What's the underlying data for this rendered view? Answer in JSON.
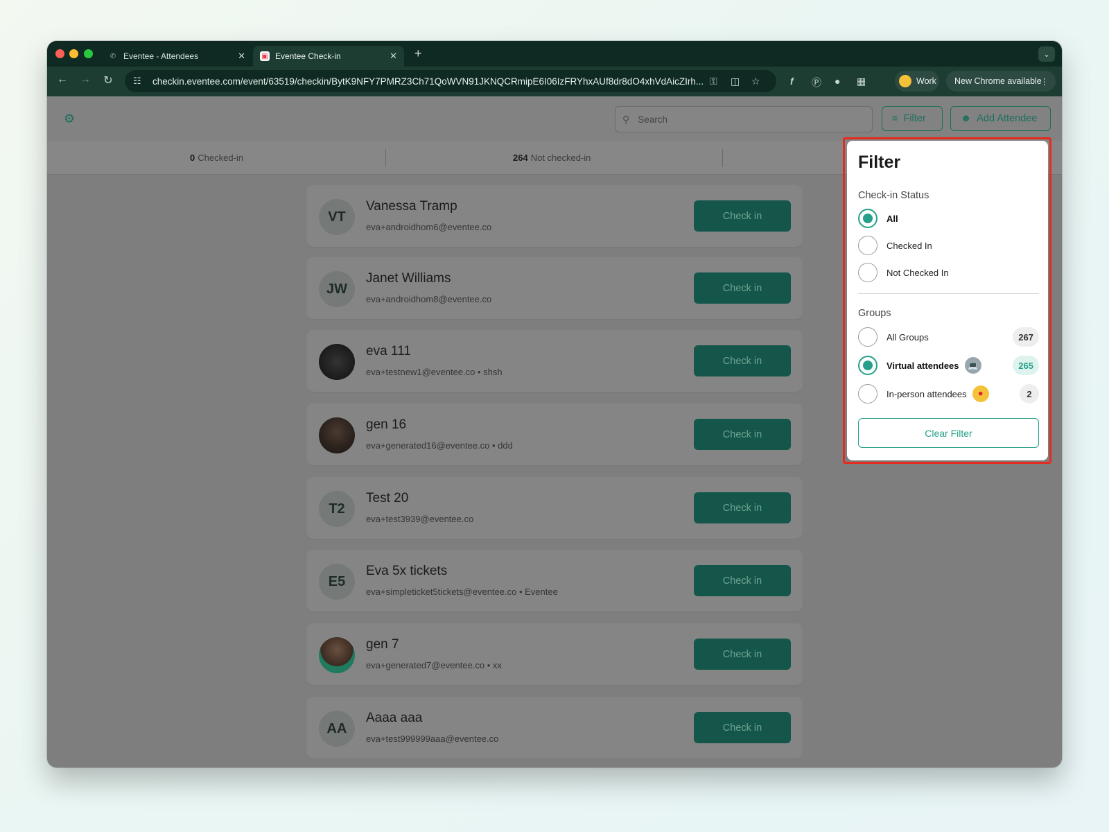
{
  "browser": {
    "tabs": [
      {
        "label": "Eventee - Attendees"
      },
      {
        "label": "Eventee Check-in"
      }
    ],
    "url": "checkin.eventee.com/event/63519/checkin/BytK9NFY7PMRZ3Ch71QoWVN91JKNQCRmipE6I06IzFRYhxAUf8dr8dO4xhVdAicZIrh...",
    "profile_label": "Work",
    "update_label": "New Chrome available"
  },
  "header": {
    "search_placeholder": "Search",
    "filter_label": "Filter",
    "add_attendee_label": "Add Attendee"
  },
  "stats": {
    "checked_in_count": "0",
    "checked_in_label": "Checked-in",
    "not_checked_in_count": "264",
    "not_checked_in_label": "Not checked-in"
  },
  "attendees": [
    {
      "initials": "VT",
      "name": "Vanessa  Tramp",
      "detail": "eva+androidhom6@eventee.co"
    },
    {
      "initials": "JW",
      "name": "Janet  Williams",
      "detail": "eva+androidhom8@eventee.co"
    },
    {
      "initials": "",
      "name": "eva 111",
      "detail": "eva+testnew1@eventee.co  •  shsh"
    },
    {
      "initials": "",
      "name": "gen 16",
      "detail": "eva+generated16@eventee.co  •  ddd"
    },
    {
      "initials": "T2",
      "name": "Test 20",
      "detail": "eva+test3939@eventee.co"
    },
    {
      "initials": "E5",
      "name": "Eva 5x tickets",
      "detail": "eva+simpleticket5tickets@eventee.co  •  Eventee"
    },
    {
      "initials": "",
      "name": "gen 7",
      "detail": "eva+generated7@eventee.co  •  xx"
    },
    {
      "initials": "AA",
      "name": "Aaaa aaa",
      "detail": "eva+test999999aaa@eventee.co"
    }
  ],
  "checkin_label": "Check in",
  "filter": {
    "title": "Filter",
    "status_label": "Check-in Status",
    "status_options": [
      "All",
      "Checked In",
      "Not Checked In"
    ],
    "groups_label": "Groups",
    "groups": [
      {
        "label": "All Groups",
        "count": "267"
      },
      {
        "label": "Virtual attendees",
        "count": "265"
      },
      {
        "label": "In-person attendees",
        "count": "2"
      }
    ],
    "clear_label": "Clear Filter"
  },
  "colors": {
    "accent": "#26a08a",
    "highlight": "#e52b1f",
    "button": "#14574a"
  }
}
